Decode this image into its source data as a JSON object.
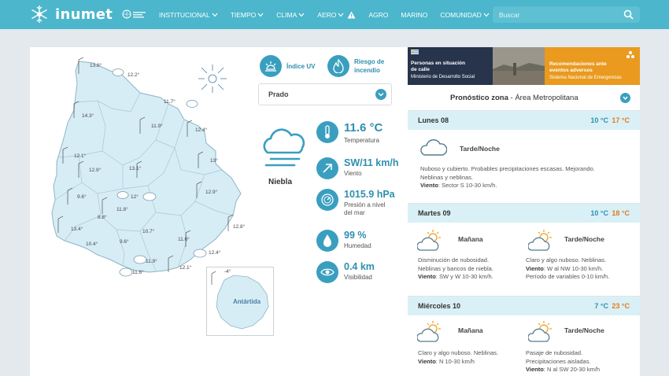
{
  "header": {
    "brand": "inumet",
    "nav": [
      {
        "label": "INSTITUCIONAL",
        "dropdown": true
      },
      {
        "label": "TIEMPO",
        "dropdown": true
      },
      {
        "label": "CLIMA",
        "dropdown": true
      },
      {
        "label": "AERO",
        "dropdown": true,
        "warning": true
      },
      {
        "label": "AGRO",
        "dropdown": false
      },
      {
        "label": "MARINO",
        "dropdown": false
      },
      {
        "label": "COMUNIDAD",
        "dropdown": true
      }
    ],
    "search_placeholder": "Buscar"
  },
  "map": {
    "stations": [
      "13.8°",
      "12.2°",
      "11.7°",
      "14.3°",
      "11.9°",
      "12.4°",
      "12.1°",
      "13°",
      "12.9°",
      "13.1°",
      "12.9°",
      "9.6°",
      "12°",
      "11.8°",
      "8.8°",
      "13.4°",
      "10.7°",
      "12.8°",
      "10.4°",
      "9.6°",
      "11.6°",
      "12.4°",
      "11.9°",
      "12.1°",
      "11.6°"
    ],
    "antarctica_label": "Antártida",
    "antarctica_temp": "-4°"
  },
  "indices": {
    "uv": "Índice UV",
    "fire_line1": "Riesgo de",
    "fire_line2": "incendio"
  },
  "location": {
    "selected": "Prado"
  },
  "current": {
    "condition": "Niebla",
    "temperature": {
      "value": "11.6 °C",
      "label": "Temperatura"
    },
    "wind": {
      "value": "SW/11 km/h",
      "label": "Viento"
    },
    "pressure": {
      "value": "1015.9 hPa",
      "label_line1": "Presión a nivel",
      "label_line2": "del mar"
    },
    "humidity": {
      "value": "99 %",
      "label": "Humedad"
    },
    "visibility": {
      "value": "0.4 km",
      "label": "Visibilidad"
    }
  },
  "banner": {
    "left_title1": "Personas en situación",
    "left_title2": "de calle",
    "left_sub": "Ministerio de Desarrollo Social",
    "right_title1": "Recomendaciones ante",
    "right_title2": "eventos adversos",
    "right_sub": "Sistema Nacional de Emergencias"
  },
  "forecast": {
    "title_bold": "Pronóstico zona",
    "title_rest": " - Área Metropolitana",
    "days": [
      {
        "name": "Lunes 08",
        "min": "10 °C",
        "max": "17 °C",
        "periods": [
          {
            "title": "Tarde/Noche",
            "desc1": "Nuboso y cubierto. Probables precipitaciones escasas. Mejorando.",
            "desc2": "Neblinas y neblinas.",
            "wind_label": "Viento",
            "wind": ": Sector S 10-30 km/h."
          }
        ]
      },
      {
        "name": "Martes 09",
        "min": "10 °C",
        "max": "18 °C",
        "periods": [
          {
            "title": "Mañana",
            "desc1": "Disminución de nubosidad.",
            "desc2": "Neblinas y bancos de niebla.",
            "wind_label": "Viento",
            "wind": ": SW y W 10-30 km/h."
          },
          {
            "title": "Tarde/Noche",
            "desc1": "Claro y algo nuboso. Neblinas.",
            "desc2": "",
            "wind_label": "Viento",
            "wind": ": W al NW 10-30 km/h.",
            "extra": "Período de variables 0-10 km/h."
          }
        ]
      },
      {
        "name": "Miércoles 10",
        "min": "7 °C",
        "max": "23 °C",
        "periods": [
          {
            "title": "Mañana",
            "desc1": "Claro y algo nuboso. Neblinas.",
            "desc2": "",
            "wind_label": "Viento",
            "wind": ": N 10-30 km/h"
          },
          {
            "title": "Tarde/Noche",
            "desc1": "Pasaje de nubosidad.",
            "desc2": "Precipitaciones aisladas.",
            "wind_label": "Viento",
            "wind": ": N al SW 20-30 km/h"
          }
        ]
      }
    ]
  },
  "colors": {
    "header": "#4bb6cc",
    "accent": "#3a9fbf",
    "accent_text": "#2e8fae",
    "max_temp": "#e57a1c",
    "day_header": "#d9f0f6",
    "map_fill": "#d7edf6"
  }
}
